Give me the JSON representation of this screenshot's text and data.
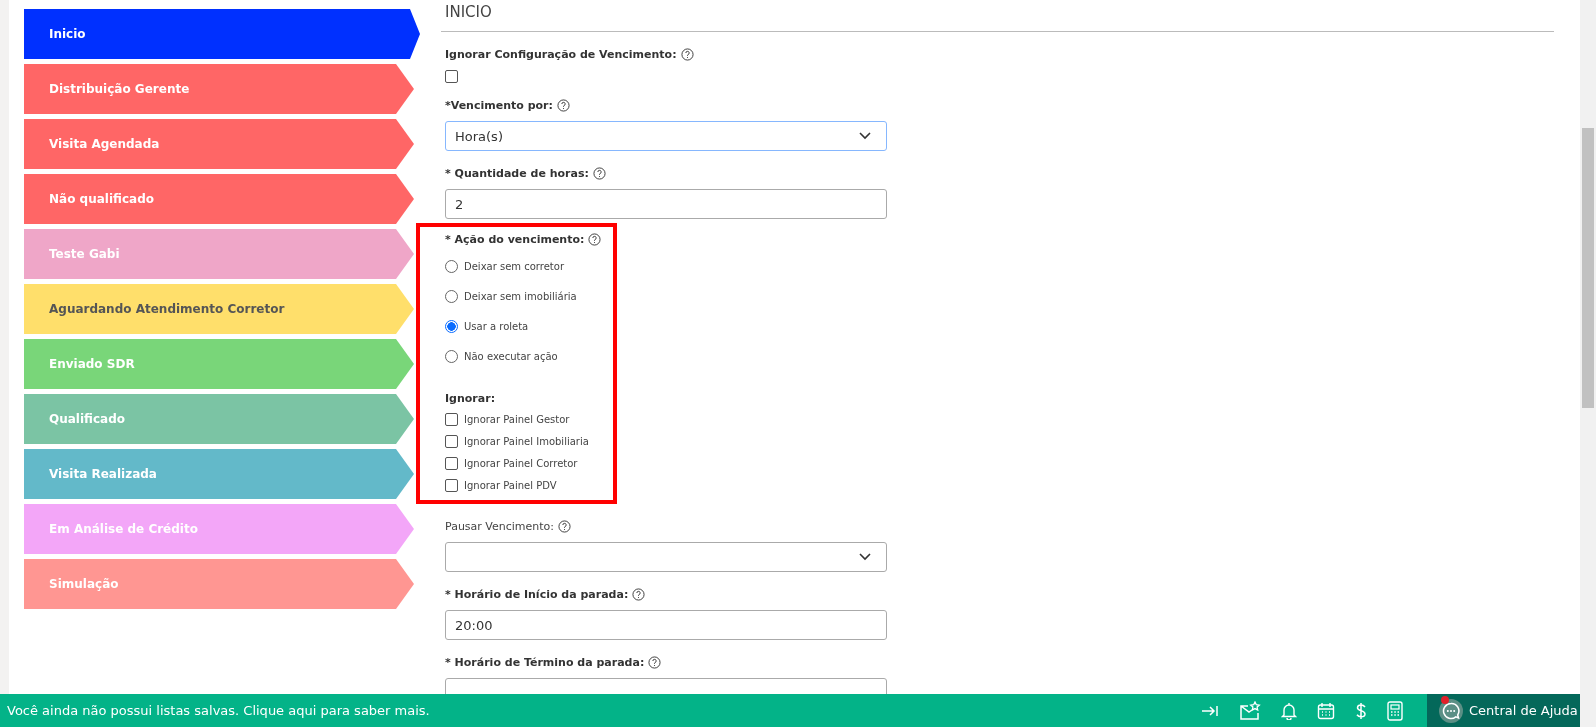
{
  "sidebar": {
    "stages": [
      {
        "label": "Inicio",
        "color": "#0030ff",
        "selected": true
      },
      {
        "label": "Distribuição Gerente",
        "color": "#ff6666",
        "selected": false
      },
      {
        "label": "Visita Agendada",
        "color": "#ff6666",
        "selected": false
      },
      {
        "label": "Não qualificado",
        "color": "#ff6666",
        "selected": false
      },
      {
        "label": "Teste Gabi",
        "color": "#efa6c8",
        "selected": false
      },
      {
        "label": "Aguardando Atendimento Corretor",
        "color": "#ffdf6b",
        "selected": false
      },
      {
        "label": "Enviado SDR",
        "color": "#79d679",
        "selected": false
      },
      {
        "label": "Qualificado",
        "color": "#7bc4a4",
        "selected": false
      },
      {
        "label": "Visita Realizada",
        "color": "#63b9c9",
        "selected": false
      },
      {
        "label": "Em Análise de Crédito",
        "color": "#f3a6f8",
        "selected": false
      },
      {
        "label": "Simulação",
        "color": "#ff9692",
        "selected": false
      }
    ]
  },
  "section": {
    "title": "INICIO"
  },
  "fields_top": [
    {
      "kind": "checkbox",
      "label": "Ignorar Configuração de Vencimento:",
      "bold": true,
      "checked": false
    },
    {
      "kind": "select",
      "label": "*Vencimento por:",
      "bold": true,
      "value": "Hora(s)",
      "focused": true
    },
    {
      "kind": "text",
      "label": "* Quantidade de horas:",
      "bold": true,
      "value": "2",
      "focused": false
    }
  ],
  "highlight": {
    "radio_group": {
      "label": "* Ação do vencimento:",
      "options": [
        {
          "label": "Deixar sem corretor",
          "selected": false
        },
        {
          "label": "Deixar sem imobiliária",
          "selected": false
        },
        {
          "label": "Usar a roleta",
          "selected": true
        },
        {
          "label": "Não executar ação",
          "selected": false
        }
      ]
    },
    "ignore_group": {
      "label": "Ignorar:",
      "options": [
        {
          "label": "Ignorar Painel Gestor",
          "checked": false
        },
        {
          "label": "Ignorar Painel Imobiliaria",
          "checked": false
        },
        {
          "label": "Ignorar Painel Corretor",
          "checked": false
        },
        {
          "label": "Ignorar Painel PDV",
          "checked": false
        }
      ]
    }
  },
  "fields_bottom": [
    {
      "kind": "select",
      "label": "Pausar Vencimento:",
      "bold": false,
      "focused": false
    },
    {
      "kind": "text",
      "label": "* Horário de Início da parada:",
      "bold": true,
      "value": "20:00",
      "focused": false
    },
    {
      "kind": "text",
      "label": "* Horário de Término da parada:",
      "bold": true,
      "focused": false
    }
  ],
  "status_bar": {
    "message": "Você ainda não possui listas salvas. Clique aqui para saber mais.",
    "help_label": "Central de Ajuda"
  }
}
